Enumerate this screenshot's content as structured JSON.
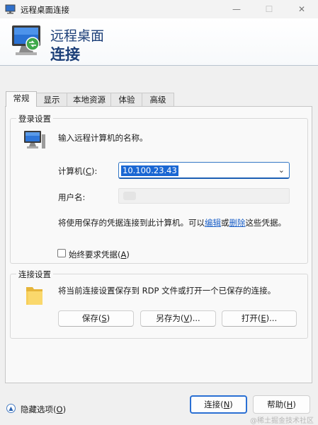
{
  "window": {
    "title": "远程桌面连接",
    "minimize_glyph": "—",
    "maximize_glyph": "☐",
    "close_glyph": "✕"
  },
  "header": {
    "line1": "远程桌面",
    "line2": "连接"
  },
  "tabs": [
    {
      "label": "常规",
      "active": true
    },
    {
      "label": "显示"
    },
    {
      "label": "本地资源"
    },
    {
      "label": "体验"
    },
    {
      "label": "高级"
    }
  ],
  "login": {
    "title": "登录设置",
    "instruction": "输入远程计算机的名称。",
    "computer_label": "计算机(",
    "computer_key": "C",
    "computer_label_end": "):",
    "computer_value": "10.100.23.43",
    "username_label": "用户名:",
    "info_prefix": "将使用保存的凭据连接到此计算机。可以",
    "edit_link": "编辑",
    "or_text": "或",
    "delete_link": "删除",
    "info_suffix": "这些凭据。",
    "always_ask_label": "始终要求凭据(",
    "always_ask_key": "A",
    "always_ask_end": ")",
    "always_ask_checked": false
  },
  "connection": {
    "title": "连接设置",
    "instruction": "将当前连接设置保存到 RDP 文件或打开一个已保存的连接。",
    "save_label": "保存(",
    "save_key": "S",
    "save_end": ")",
    "save_as_label": "另存为(",
    "save_as_key": "V",
    "save_as_end": ")...",
    "open_label": "打开(",
    "open_key": "E",
    "open_end": ")..."
  },
  "footer": {
    "hide_options_label": "隐藏选项(",
    "hide_options_key": "O",
    "hide_options_end": ")",
    "connect_label": "连接(",
    "connect_key": "N",
    "connect_end": ")",
    "help_label": "帮助(",
    "help_key": "H",
    "help_end": ")"
  },
  "watermark": "@稀土掘金技术社区",
  "colors": {
    "accent": "#2a6fd3",
    "header_text": "#1c3f78",
    "link": "#1a5fc7"
  }
}
